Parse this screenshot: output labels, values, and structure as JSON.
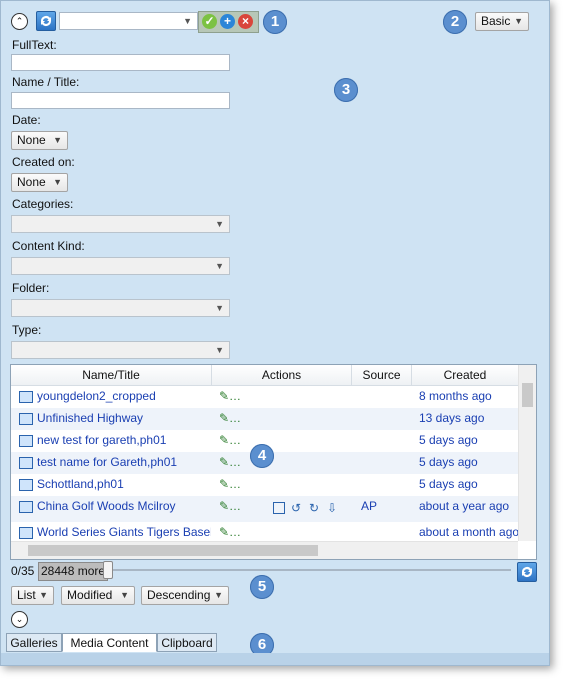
{
  "toolbar": {
    "collapse_icon": "chevron-up-icon",
    "refresh_icon": "refresh-icon",
    "search_combo_value": "",
    "confirm_icon": "check-icon",
    "add_icon": "plus-icon",
    "clear_icon": "x-icon",
    "mode_select": "Basic"
  },
  "badges": [
    "1",
    "2",
    "3",
    "4",
    "5",
    "6"
  ],
  "filters": {
    "fulltext_label": "FullText:",
    "name_title_label": "Name / Title:",
    "date_label": "Date:",
    "date_value": "None",
    "created_on_label": "Created on:",
    "created_on_value": "None",
    "categories_label": "Categories:",
    "content_kind_label": "Content Kind:",
    "folder_label": "Folder:",
    "type_label": "Type:"
  },
  "grid": {
    "columns": [
      "Name/Title",
      "Actions",
      "Source",
      "Created"
    ],
    "rows": [
      {
        "name": "youngdelon2_cropped",
        "source": "",
        "created": "8 months ago"
      },
      {
        "name": "Unfinished Highway",
        "source": "",
        "created": "13 days ago"
      },
      {
        "name": "new test for gareth,ph01",
        "source": "",
        "created": "5 days ago"
      },
      {
        "name": "test name for Gareth,ph01",
        "source": "",
        "created": "5 days ago"
      },
      {
        "name": "Schottland,ph01",
        "source": "",
        "created": "5 days ago"
      },
      {
        "name": "China Golf Woods Mcilroy",
        "source": "AP",
        "created": "about a year ago"
      },
      {
        "name": "World Series Giants Tigers Baseball",
        "source": "",
        "created": "about a month ago"
      }
    ]
  },
  "paging": {
    "count": "0/35",
    "more": "28448 more"
  },
  "sort": {
    "view": "List",
    "field": "Modified",
    "order": "Descending"
  },
  "tabs": [
    "Galleries",
    "Media Content",
    "Clipboard"
  ],
  "colors": {
    "panel_bg": "#cfe3f3",
    "badge": "#5b8fcf",
    "link": "#1a3fb2"
  }
}
